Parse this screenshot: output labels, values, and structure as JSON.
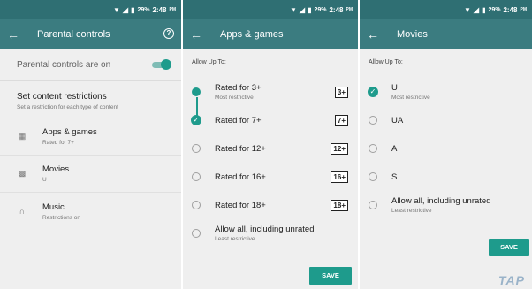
{
  "status": {
    "battery": "29%",
    "time": "2:48",
    "ampm": "PM"
  },
  "screen1": {
    "title": "Parental controls",
    "toggle_label": "Parental controls are on",
    "section_title": "Set content restrictions",
    "section_sub": "Set a restriction for each type of content",
    "categories": [
      {
        "title": "Apps & games",
        "sub": "Rated for 7+",
        "icon": "grid-icon"
      },
      {
        "title": "Movies",
        "sub": "U",
        "icon": "film-icon"
      },
      {
        "title": "Music",
        "sub": "Restrictions on",
        "icon": "headphones-icon"
      }
    ]
  },
  "screen2": {
    "title": "Apps & games",
    "allow_label": "Allow Up To:",
    "options": [
      {
        "label": "Rated for 3+",
        "sub": "Most restrictive",
        "badge": "3+"
      },
      {
        "label": "Rated for 7+",
        "badge": "7+"
      },
      {
        "label": "Rated for 12+",
        "badge": "12+"
      },
      {
        "label": "Rated for 16+",
        "badge": "16+"
      },
      {
        "label": "Rated for 18+",
        "badge": "18+"
      },
      {
        "label": "Allow all, including unrated",
        "sub": "Least restrictive"
      }
    ],
    "save_label": "SAVE"
  },
  "screen3": {
    "title": "Movies",
    "allow_label": "Allow Up To:",
    "options": [
      {
        "label": "U",
        "sub": "Most restrictive"
      },
      {
        "label": "UA"
      },
      {
        "label": "A"
      },
      {
        "label": "S"
      },
      {
        "label": "Allow all, including unrated",
        "sub": "Least restrictive"
      }
    ],
    "save_label": "SAVE"
  },
  "watermark": "TAP",
  "colors": {
    "statusbar": "#2f6f73",
    "toolbar": "#3b7c80",
    "accent": "#1e9b8c"
  }
}
